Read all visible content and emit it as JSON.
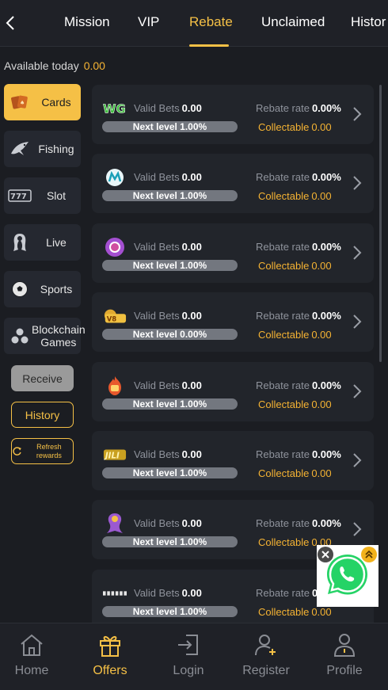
{
  "header": {
    "tabs": [
      {
        "label": "Mission"
      },
      {
        "label": "VIP"
      },
      {
        "label": "Rebate"
      },
      {
        "label": "Unclaimed"
      },
      {
        "label": "Histor"
      }
    ],
    "active_tab": "Rebate"
  },
  "summary": {
    "available_label": "Available today",
    "available_value": "0.00"
  },
  "sidebar": {
    "items": [
      {
        "label": "Cards",
        "icon": "cards-icon"
      },
      {
        "label": "Fishing",
        "icon": "fish-icon"
      },
      {
        "label": "Slot",
        "icon": "slot-777-icon"
      },
      {
        "label": "Live",
        "icon": "live-dealer-icon"
      },
      {
        "label": "Sports",
        "icon": "soccer-ball-icon"
      },
      {
        "label": "Blockchain Games",
        "icon": "blockchain-icon"
      }
    ],
    "receive_label": "Receive",
    "history_label": "History",
    "refresh_label": "Refresh rewards"
  },
  "rebates": [
    {
      "provider_icon": "wg-logo-icon",
      "valid_bets_label": "Valid Bets",
      "valid_bets": "0.00",
      "next_level": "Next level 1.00%",
      "progress": 0,
      "rebate_rate_label": "Rebate rate",
      "rebate_rate": "0.00%",
      "collectable_label": "Collectable",
      "collectable": "0.00"
    },
    {
      "provider_icon": "microgaming-logo-icon",
      "valid_bets_label": "Valid Bets",
      "valid_bets": "0.00",
      "next_level": "Next level 1.00%",
      "progress": 0,
      "rebate_rate_label": "Rebate rate",
      "rebate_rate": "0.00%",
      "collectable_label": "Collectable",
      "collectable": "0.00"
    },
    {
      "provider_icon": "chip-logo-icon",
      "valid_bets_label": "Valid Bets",
      "valid_bets": "0.00",
      "next_level": "Next level 1.00%",
      "progress": 0,
      "rebate_rate_label": "Rebate rate",
      "rebate_rate": "0.00%",
      "collectable_label": "Collectable",
      "collectable": "0.00"
    },
    {
      "provider_icon": "v8-logo-icon",
      "valid_bets_label": "Valid Bets",
      "valid_bets": "0.00",
      "next_level": "Next level 0.00%",
      "progress": 0,
      "rebate_rate_label": "Rebate rate",
      "rebate_rate": "0.00%",
      "collectable_label": "Collectable",
      "collectable": "0.00"
    },
    {
      "provider_icon": "fire-logo-icon",
      "valid_bets_label": "Valid Bets",
      "valid_bets": "0.00",
      "next_level": "Next level 1.00%",
      "progress": 0,
      "rebate_rate_label": "Rebate rate",
      "rebate_rate": "0.00%",
      "collectable_label": "Collectable",
      "collectable": "0.00"
    },
    {
      "provider_icon": "jili-logo-icon",
      "valid_bets_label": "Valid Bets",
      "valid_bets": "0.00",
      "next_level": "Next level 1.00%",
      "progress": 0,
      "rebate_rate_label": "Rebate rate",
      "rebate_rate": "0.00%",
      "collectable_label": "Collectable",
      "collectable": "0.00"
    },
    {
      "provider_icon": "mermaid-logo-icon",
      "valid_bets_label": "Valid Bets",
      "valid_bets": "0.00",
      "next_level": "Next level 1.00%",
      "progress": 0,
      "rebate_rate_label": "Rebate rate",
      "rebate_rate": "0.00%",
      "collectable_label": "Collectable",
      "collectable": "0.00"
    },
    {
      "provider_icon": "dots-logo-icon",
      "valid_bets_label": "Valid Bets",
      "valid_bets": "0.00",
      "next_level": "Next level 1.00%",
      "progress": 0,
      "rebate_rate_label": "Rebate rate",
      "rebate_rate": "0.00%",
      "collectable_label": "Collectable",
      "collectable": "0.00"
    }
  ],
  "bottom_nav": {
    "items": [
      {
        "label": "Home",
        "icon": "home-icon"
      },
      {
        "label": "Offers",
        "icon": "gift-icon"
      },
      {
        "label": "Login",
        "icon": "login-icon"
      },
      {
        "label": "Register",
        "icon": "register-icon"
      },
      {
        "label": "Profile",
        "icon": "profile-icon"
      }
    ],
    "active": "Offers"
  },
  "colors": {
    "accent": "#f5c046",
    "background": "#1b1d22",
    "card": "#22252b",
    "whatsapp": "#25d366"
  }
}
